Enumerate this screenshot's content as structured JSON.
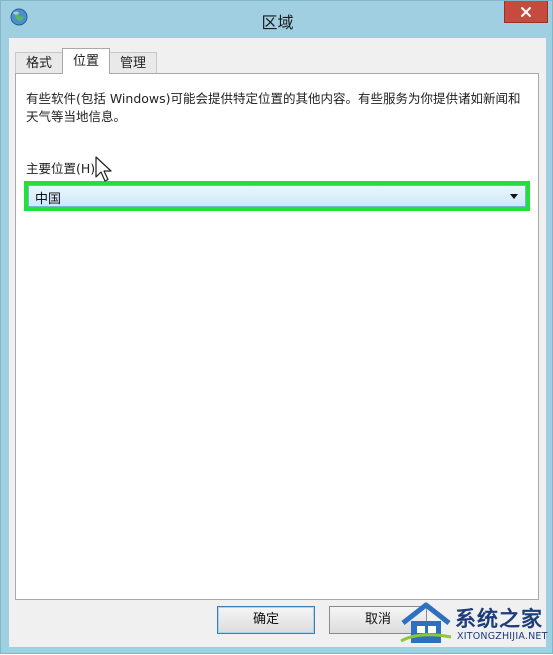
{
  "window": {
    "title": "区域",
    "close_icon": "close-icon",
    "app_icon": "globe-icon"
  },
  "tabs": [
    {
      "label": "格式",
      "active": false
    },
    {
      "label": "位置",
      "active": true
    },
    {
      "label": "管理",
      "active": false
    }
  ],
  "location_panel": {
    "description": "有些软件(包括 Windows)可能会提供特定位置的其他内容。有些服务为你提供诸如新闻和天气等当地信息。",
    "home_location_label": "主要位置(H):",
    "home_location_value": "中国"
  },
  "footer": {
    "ok_label": "确定",
    "cancel_label": "取消"
  },
  "watermark": {
    "name": "系统之家",
    "url": "XITONGZHIJIA.NET"
  },
  "colors": {
    "highlight_border": "#22e03a",
    "window_frame": "#9fcfe0",
    "close_button": "#c74a3e"
  }
}
